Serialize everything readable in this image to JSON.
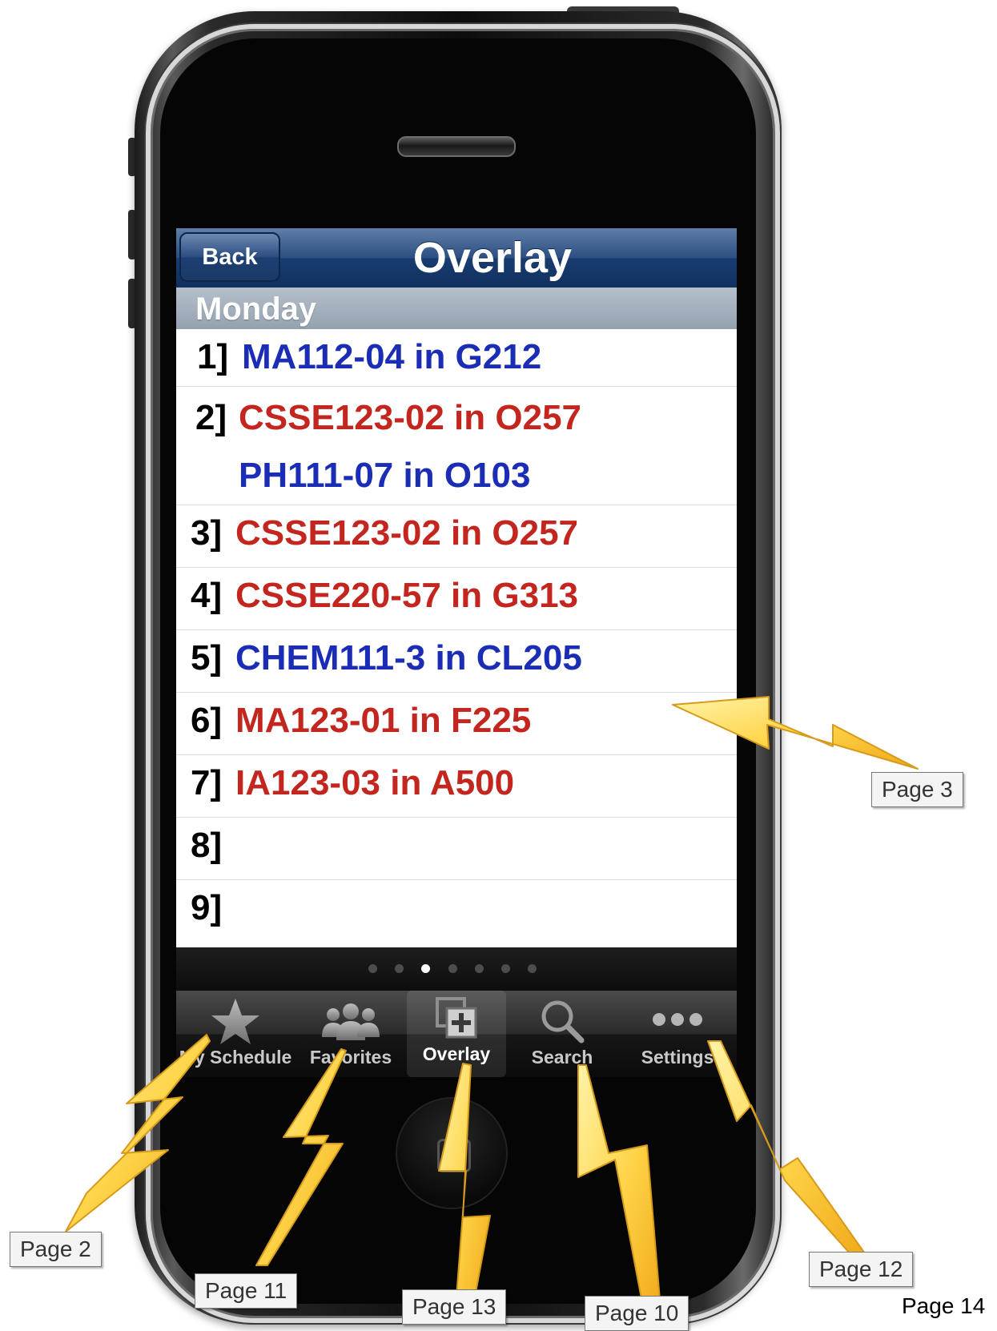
{
  "screen": {
    "nav_bar": {
      "back_label": "Back",
      "title": "Overlay"
    },
    "section_header": "Monday",
    "rows": [
      {
        "number": "1]",
        "entries": [
          {
            "text": "MA112-04 in G212",
            "color": "#1a2db4"
          }
        ]
      },
      {
        "number": "2]",
        "entries": [
          {
            "text": "CSSE123-02 in O257",
            "color": "#c3261e"
          },
          {
            "text": "PH111-07 in O103",
            "color": "#1a2db4"
          }
        ]
      },
      {
        "number": "3]",
        "entries": [
          {
            "text": "CSSE123-02 in O257",
            "color": "#c3261e"
          }
        ]
      },
      {
        "number": "4]",
        "entries": [
          {
            "text": "CSSE220-57 in G313",
            "color": "#c3261e"
          }
        ]
      },
      {
        "number": "5]",
        "entries": [
          {
            "text": "CHEM111-3 in CL205",
            "color": "#1a2db4"
          }
        ]
      },
      {
        "number": "6]",
        "entries": [
          {
            "text": "MA123-01 in F225",
            "color": "#c3261e"
          }
        ]
      },
      {
        "number": "7]",
        "entries": [
          {
            "text": "IA123-03 in A500",
            "color": "#c3261e"
          }
        ]
      },
      {
        "number": "8]",
        "entries": []
      },
      {
        "number": "9]",
        "entries": []
      }
    ],
    "page_indicator": {
      "count": 7,
      "active_index": 2
    },
    "tab_bar": [
      {
        "label": "My Schedule",
        "icon": "star-icon"
      },
      {
        "label": "Favorites",
        "icon": "people-icon"
      },
      {
        "label": "Overlay",
        "icon": "overlay-icon",
        "selected": true
      },
      {
        "label": "Search",
        "icon": "search-icon"
      },
      {
        "label": "Settings",
        "icon": "more-icon"
      }
    ]
  },
  "annotations": {
    "callouts": [
      "Page 3",
      "Page 2",
      "Page 11",
      "Page 13",
      "Page 10",
      "Page 12"
    ],
    "page_number": "Page 14"
  },
  "colors": {
    "course_blue": "#1a2db4",
    "course_red": "#c3261e",
    "nav_bar": "#1d3f72",
    "bolt_fill": "#ffd54a"
  }
}
